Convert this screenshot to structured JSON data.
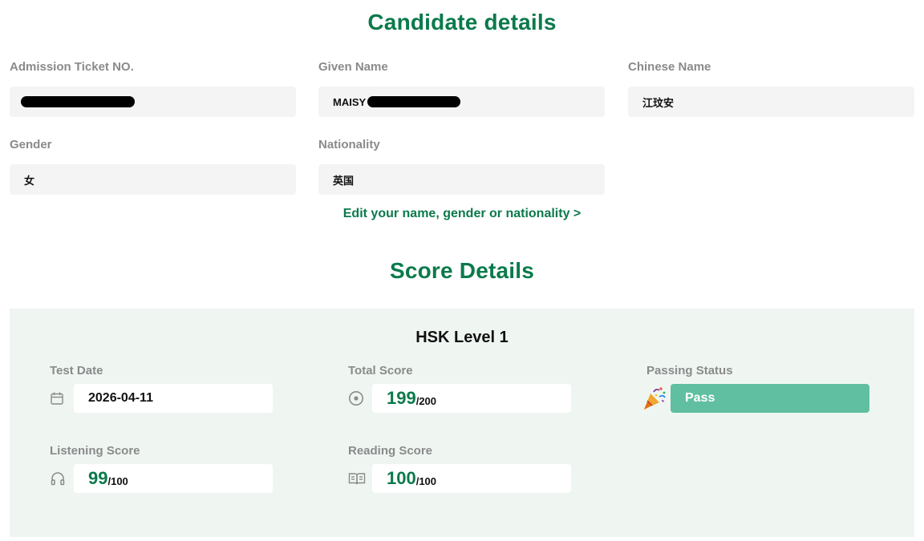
{
  "candidate": {
    "title": "Candidate details",
    "fields": {
      "admission_label": "Admission Ticket NO.",
      "admission_value": "",
      "given_name_label": "Given Name",
      "given_name_value": "MAISY",
      "chinese_name_label": "Chinese Name",
      "chinese_name_value": "江玟安",
      "gender_label": "Gender",
      "gender_value": "女",
      "nationality_label": "Nationality",
      "nationality_value": "英国"
    },
    "edit_link": "Edit your name, gender or nationality >"
  },
  "score": {
    "title": "Score Details",
    "level": "HSK Level 1",
    "test_date_label": "Test Date",
    "test_date_value": "2026-04-11",
    "total_label": "Total Score",
    "total_value": "199",
    "total_max": "/200",
    "passing_label": "Passing Status",
    "passing_value": "Pass",
    "listening_label": "Listening Score",
    "listening_value": "99",
    "listening_max": "/100",
    "reading_label": "Reading Score",
    "reading_value": "100",
    "reading_max": "/100"
  },
  "colors": {
    "accent_green": "#0b7a4b",
    "pass_badge": "#5fbfa0",
    "panel_bg": "#eff6f2",
    "field_bg": "#f4f4f4"
  },
  "icons": {
    "test_date": "calendar-icon",
    "total": "target-icon",
    "passing": "party-popper-icon",
    "listening": "headphones-icon",
    "reading": "book-icon"
  }
}
